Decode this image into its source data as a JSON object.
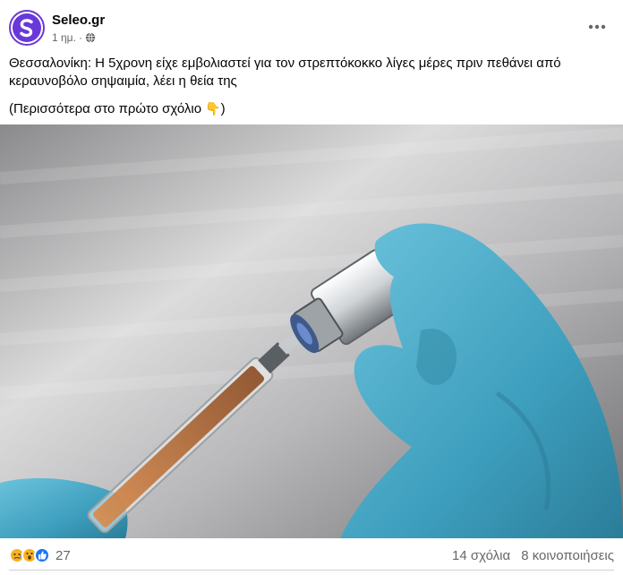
{
  "post": {
    "author": "Seleo.gr",
    "time": "1 ημ.",
    "separator": "·",
    "text_line": "Θεσσαλονίκη: Η 5χρονη είχε εμβολιαστεί για τον στρεπτόκοκκο λίγες μέρες πριν πεθάνει από κεραυνοβόλο σηψαιμία, λέει η θεία της",
    "more_text": "(Περισσότερα στο πρώτο σχόλιο",
    "more_emoji": "👇",
    "more_close": ")"
  },
  "footer": {
    "reaction_count": "27",
    "comments": "14 σχόλια",
    "shares": "8 κοινοποιήσεις"
  },
  "colors": {
    "brand_purple": "#6a38d8",
    "glove_blue": "#4aa9c7",
    "like_blue": "#1877f2",
    "reaction_yellow": "#f7b125"
  },
  "icons": {
    "more": "more-horizontal-icon",
    "privacy": "globe-icon",
    "reactions": [
      "sad-reaction-icon",
      "wow-reaction-icon",
      "like-reaction-icon"
    ]
  }
}
